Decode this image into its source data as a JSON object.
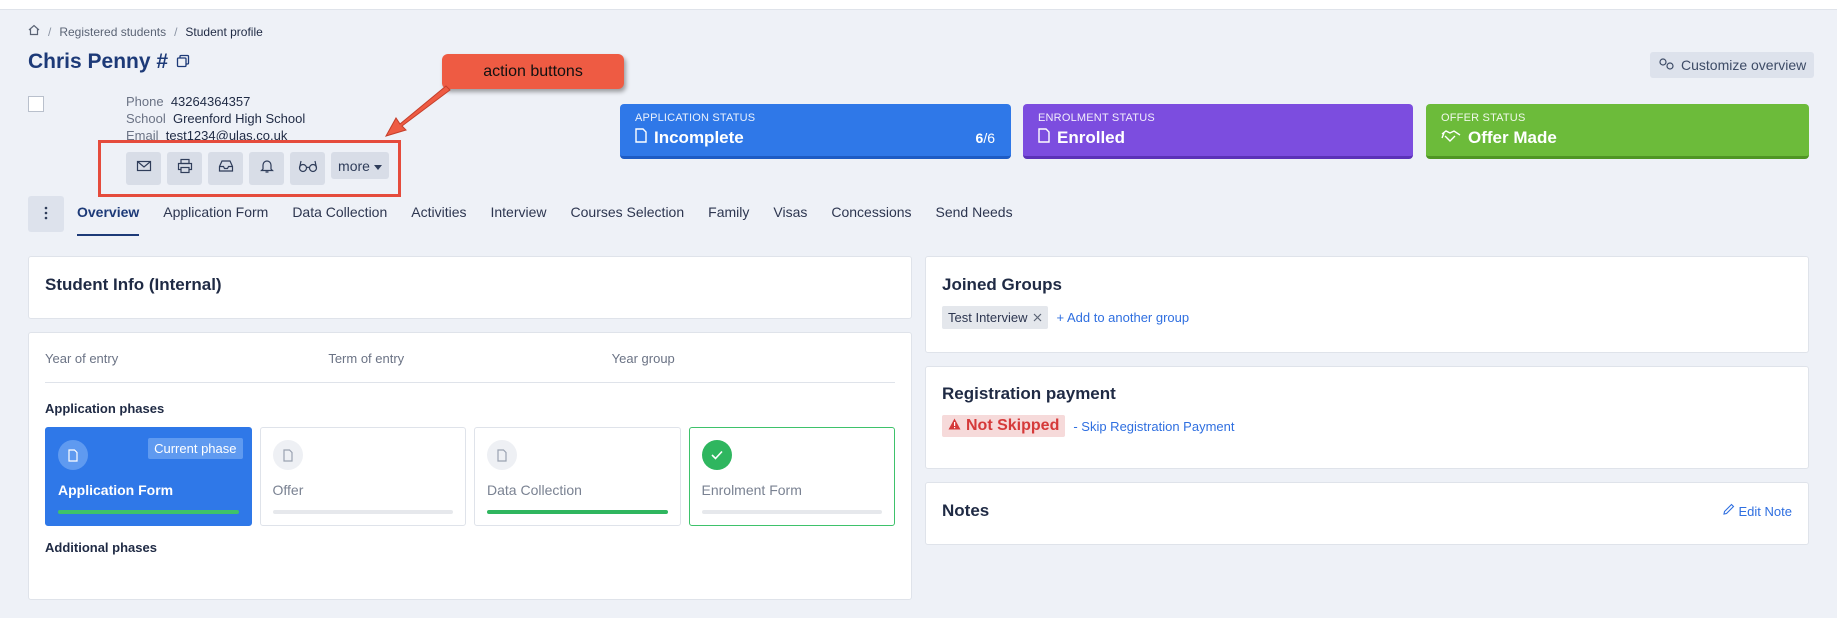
{
  "breadcrumb": {
    "home_icon": "home-icon",
    "item1": "Registered students",
    "item2": "Student profile",
    "sep": "/"
  },
  "student": {
    "name": "Chris Penny #",
    "phone_label": "Phone",
    "phone": "43264364357",
    "school_label": "School",
    "school": "Greenford High School",
    "email_label": "Email",
    "email": "test1234@ulas.co.uk"
  },
  "customize_label": "Customize overview",
  "annotation": {
    "callout": "action buttons"
  },
  "actions": {
    "more_label": "more"
  },
  "statuses": {
    "application": {
      "label": "APPLICATION STATUS",
      "value": "Incomplete",
      "count_done": "6",
      "count_total": "/6"
    },
    "enrolment": {
      "label": "ENROLMENT STATUS",
      "value": "Enrolled"
    },
    "offer": {
      "label": "OFFER STATUS",
      "value": "Offer Made"
    }
  },
  "tabs": [
    "Overview",
    "Application Form",
    "Data Collection",
    "Activities",
    "Interview",
    "Courses Selection",
    "Family",
    "Visas",
    "Concessions",
    "Send Needs"
  ],
  "internal": {
    "title": "Student Info (Internal)"
  },
  "fields": {
    "year_of_entry": "Year of entry",
    "term_of_entry": "Term of entry",
    "year_group": "Year group"
  },
  "phases": {
    "title": "Application phases",
    "current_badge": "Current phase",
    "items": [
      "Application Form",
      "Offer",
      "Data Collection",
      "Enrolment Form"
    ],
    "additional_title": "Additional phases"
  },
  "groups": {
    "title": "Joined Groups",
    "chip": "Test Interview",
    "add_link": "+ Add to another group"
  },
  "payment": {
    "title": "Registration payment",
    "badge": "Not Skipped",
    "skip_link": "- Skip Registration Payment"
  },
  "notes": {
    "title": "Notes",
    "edit_link": "Edit Note"
  },
  "colors": {
    "accent": "#2f78e8",
    "enrolment": "#7c4ddf",
    "offer": "#6cbb3a",
    "danger": "#d53a3a",
    "annotation": "#ee5b43"
  }
}
